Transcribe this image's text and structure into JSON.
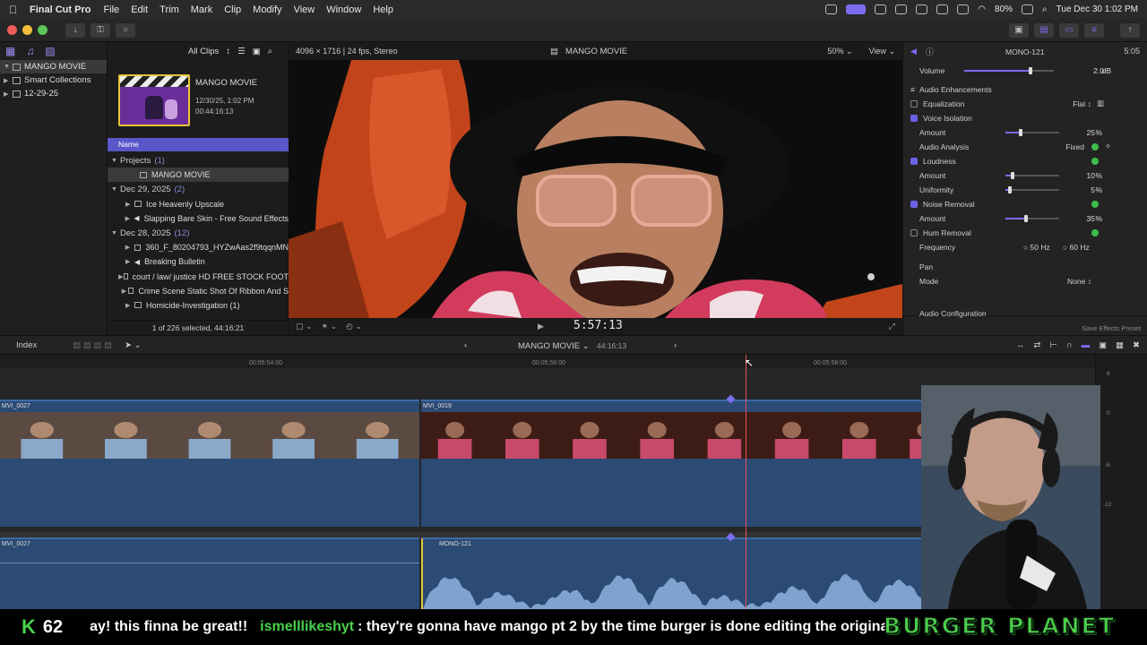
{
  "menubar": {
    "app_name": "Final Cut Pro",
    "items": [
      "File",
      "Edit",
      "Trim",
      "Mark",
      "Clip",
      "Modify",
      "View",
      "Window",
      "Help"
    ],
    "battery": "80%",
    "datetime": "Tue Dec 30  1:02 PM"
  },
  "libraries": {
    "rows": [
      {
        "label": "MANGO MOVIE",
        "selected": true
      },
      {
        "label": "Smart Collections"
      },
      {
        "label": "12-29-25"
      }
    ]
  },
  "browser": {
    "filter_label": "All Clips",
    "project_title": "MANGO MOVIE",
    "project_date": "12/30/25, 1:02 PM",
    "project_duration": "00:44:16:13",
    "column_name": "Name",
    "rows": [
      {
        "type": "group",
        "label": "Projects",
        "count": "(1)"
      },
      {
        "type": "item",
        "label": "MANGO MOVIE",
        "selected": true
      },
      {
        "type": "group",
        "label": "Dec 29, 2025",
        "count": "(2)"
      },
      {
        "type": "item",
        "label": "Ice Heavenly Upscale"
      },
      {
        "type": "item",
        "label": "Slapping Bare Skin - Free Sound Effects"
      },
      {
        "type": "group",
        "label": "Dec 28, 2025",
        "count": "(12)"
      },
      {
        "type": "item",
        "label": "360_F_80204793_HYZwAas2f9tqqnMN"
      },
      {
        "type": "item",
        "label": "Breaking Bulletin"
      },
      {
        "type": "item",
        "label": "court / law/ justice HD FREE STOCK FOOT"
      },
      {
        "type": "item",
        "label": "Crime Scene Static Shot Of Ribbon And S"
      },
      {
        "type": "item",
        "label": "Homicide-Investigation (1)"
      }
    ],
    "footer": "1 of 226 selected, 44:16:21"
  },
  "viewer": {
    "format": "4096 × 1716 | 24 fps, Stereo",
    "title": "MANGO MOVIE",
    "zoom": "50%",
    "view_label": "View",
    "timecode": "5:57:13"
  },
  "inspector": {
    "clip_name": "MONO-121",
    "duration": "5:05",
    "volume_label": "Volume",
    "volume_value": "2.0",
    "volume_unit": "dB",
    "section_enhancements": "Audio Enhancements",
    "equalization_label": "Equalization",
    "equalization_value": "Flat",
    "voice_isolation_label": "Voice Isolation",
    "amount_label": "Amount",
    "voice_amount": "25",
    "percent": "%",
    "analysis_label": "Audio Analysis",
    "analysis_value": "Fixed",
    "loudness_label": "Loudness",
    "loudness_amount": "10",
    "uniformity_label": "Uniformity",
    "uniformity_value": "5",
    "noise_removal_label": "Noise Removal",
    "noise_amount": "35",
    "hum_removal_label": "Hum Removal",
    "frequency_label": "Frequency",
    "freq_50": "50 Hz",
    "freq_60": "60 Hz",
    "pan_label": "Pan",
    "mode_label": "Mode",
    "mode_value": "None",
    "audio_config_label": "Audio Configuration",
    "save_preset_label": "Save Effects Preset"
  },
  "timeline": {
    "index_label": "Index",
    "project_name": "MANGO MOVIE",
    "project_duration": "44:16:13",
    "ruler": [
      "00:05:54:00",
      "00:05:56:00",
      "00:05:58:00"
    ],
    "clips": {
      "video_left": "MVI_0027",
      "video_right": "MVI_0019",
      "audio_left": "MVI_0027",
      "audio_right": "MONO-121"
    },
    "meter_labels": [
      "6",
      "0",
      "-6",
      "-12"
    ]
  },
  "ticker": {
    "k_letter": "K",
    "k_number": "62",
    "message_tail": "ay! this finna be great!!",
    "username": "ismelllikeshyt",
    "message": ": they're gonna have mango pt 2 by the time burger is done editing the original",
    "logo_text": "BURGER PLANET"
  },
  "colors": {
    "accent": "#7b6cf0",
    "clip_blue": "#2b4a74",
    "playhead": "#e8545a",
    "ticker_green": "#49d14a"
  }
}
